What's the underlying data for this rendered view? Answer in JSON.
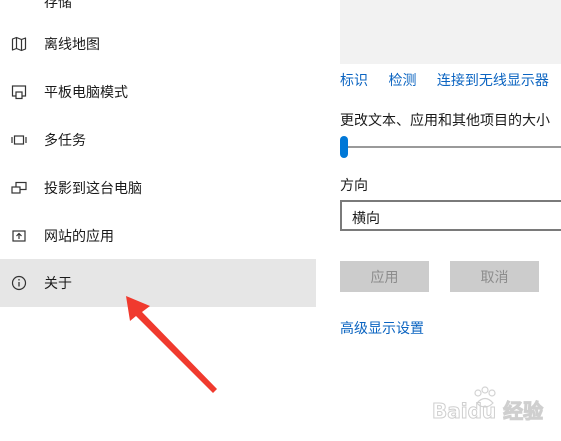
{
  "sidebar": {
    "items": [
      {
        "label": "存储",
        "icon": "storage-icon"
      },
      {
        "label": "离线地图",
        "icon": "offline-map-icon"
      },
      {
        "label": "平板电脑模式",
        "icon": "tablet-mode-icon"
      },
      {
        "label": "多任务",
        "icon": "multitasking-icon"
      },
      {
        "label": "投影到这台电脑",
        "icon": "project-to-pc-icon"
      },
      {
        "label": "网站的应用",
        "icon": "apps-for-websites-icon"
      },
      {
        "label": "关于",
        "icon": "about-info-icon"
      }
    ],
    "selected_index": 6,
    "selected_bg": "#e6e6e6"
  },
  "display": {
    "links": [
      "标识",
      "检测",
      "连接到无线显示器"
    ],
    "scale_label": "更改文本、应用和其他项目的大小",
    "scale_value": 0.0,
    "orientation_label": "方向",
    "orientation_value": "横向",
    "apply_label": "应用",
    "cancel_label": "取消",
    "advanced_link": "高级显示设置"
  },
  "colors": {
    "link": "#0b64c1",
    "accent": "#0078d7",
    "arrow": "#f03a2e",
    "disabled_button": "#cccccc"
  },
  "watermark": {
    "text": "Baidu 经验"
  }
}
